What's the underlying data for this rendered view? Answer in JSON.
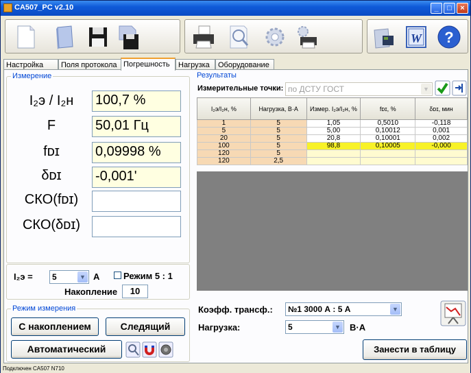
{
  "window": {
    "title": "CA507_PC v2.10"
  },
  "tabs": [
    "Настройка",
    "Поля протокола",
    "Погрешность",
    "Нагрузка",
    "Оборудование"
  ],
  "measurement": {
    "group_label": "Измерение",
    "rows": [
      {
        "label": "I₂э / I₂н",
        "value": "100,7 %"
      },
      {
        "label": "F",
        "value": "50,01 Гц"
      },
      {
        "label": "fᴅɪ",
        "value": "0,09998 %"
      },
      {
        "label": "δᴅɪ",
        "value": "-0,001'"
      },
      {
        "label": "СКО(fᴅɪ)",
        "value": ""
      },
      {
        "label": "СКО(δᴅɪ)",
        "value": ""
      }
    ]
  },
  "current": {
    "label": "I₂э =",
    "value": "5",
    "unit": "А",
    "mode_checkbox": "Режим 5 : 1",
    "accum_label": "Накопление",
    "accum_value": "10"
  },
  "mode": {
    "group_label": "Режим измерения",
    "accumulate_button": "С накоплением",
    "follow_button": "Следящий",
    "auto_button": "Автоматический"
  },
  "results": {
    "group_label": "Результаты",
    "points_label": "Измерительные точки:",
    "points_value": "по ДСТУ ГОСТ",
    "columns": [
      "I₂э/I₂н, %",
      "Нагрузка, В·А",
      "Измер. I₂э/I₂н, %",
      "fᴅɪ, %",
      "δᴅɪ, мин"
    ],
    "rows": [
      [
        "1",
        "5",
        "1,05",
        "0,5010",
        "-0,118"
      ],
      [
        "5",
        "5",
        "5,00",
        "0,10012",
        "0,001"
      ],
      [
        "20",
        "5",
        "20,8",
        "0,10001",
        "0,002"
      ],
      [
        "100",
        "5",
        "98,8",
        "0,10005",
        "-0,000"
      ],
      [
        "120",
        "5",
        "",
        "",
        ""
      ],
      [
        "120",
        "2,5",
        "",
        "",
        ""
      ]
    ]
  },
  "transform": {
    "coeff_label": "Коэфф. трансф.:",
    "coeff_value": "№1  3000 А : 5 А",
    "load_label": "Нагрузка:",
    "load_value": "5",
    "load_unit": "В·А",
    "add_button": "Занести в таблицу"
  },
  "status": "Подключен CA507 N710",
  "colors": {
    "highlight": "#f8f228",
    "peach": "#f7d9b4",
    "value_bg": "#ffffe1",
    "group_label": "#0046d5"
  }
}
